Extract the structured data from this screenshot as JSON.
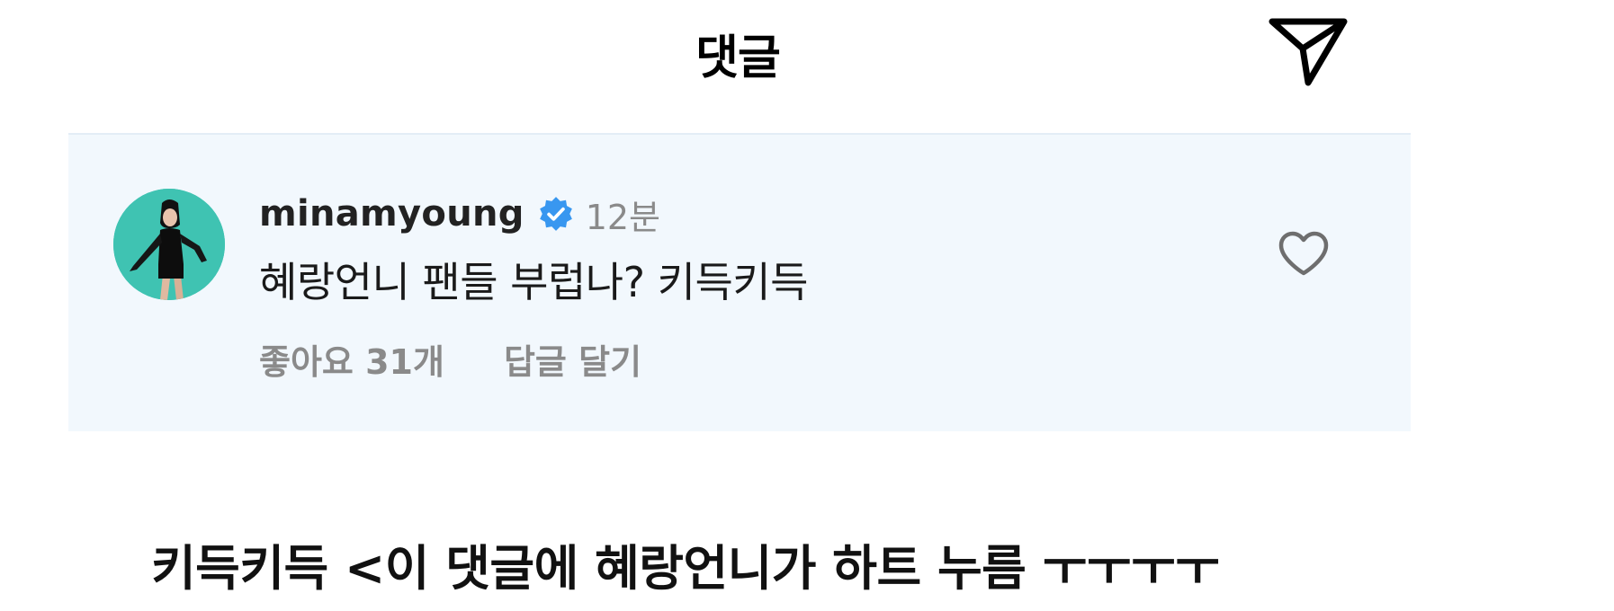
{
  "header": {
    "title": "댓글",
    "share_icon": "send-icon"
  },
  "comment": {
    "avatar_icon": "avatar",
    "username": "minamyoung",
    "verified_icon": "verified-badge-icon",
    "verified_color": "#3897f0",
    "timestamp": "12분",
    "text": "혜랑언니 팬들 부럽나? 키득키득",
    "likes_label": "좋아요 31개",
    "reply_label": "답글 달기",
    "like_icon": "heart-icon",
    "background_color": "#f2f8fd"
  },
  "caption": {
    "text": "키득키득 <이 댓글에 혜랑언니가 하트 누름 ㅜㅜㅜㅜ"
  }
}
